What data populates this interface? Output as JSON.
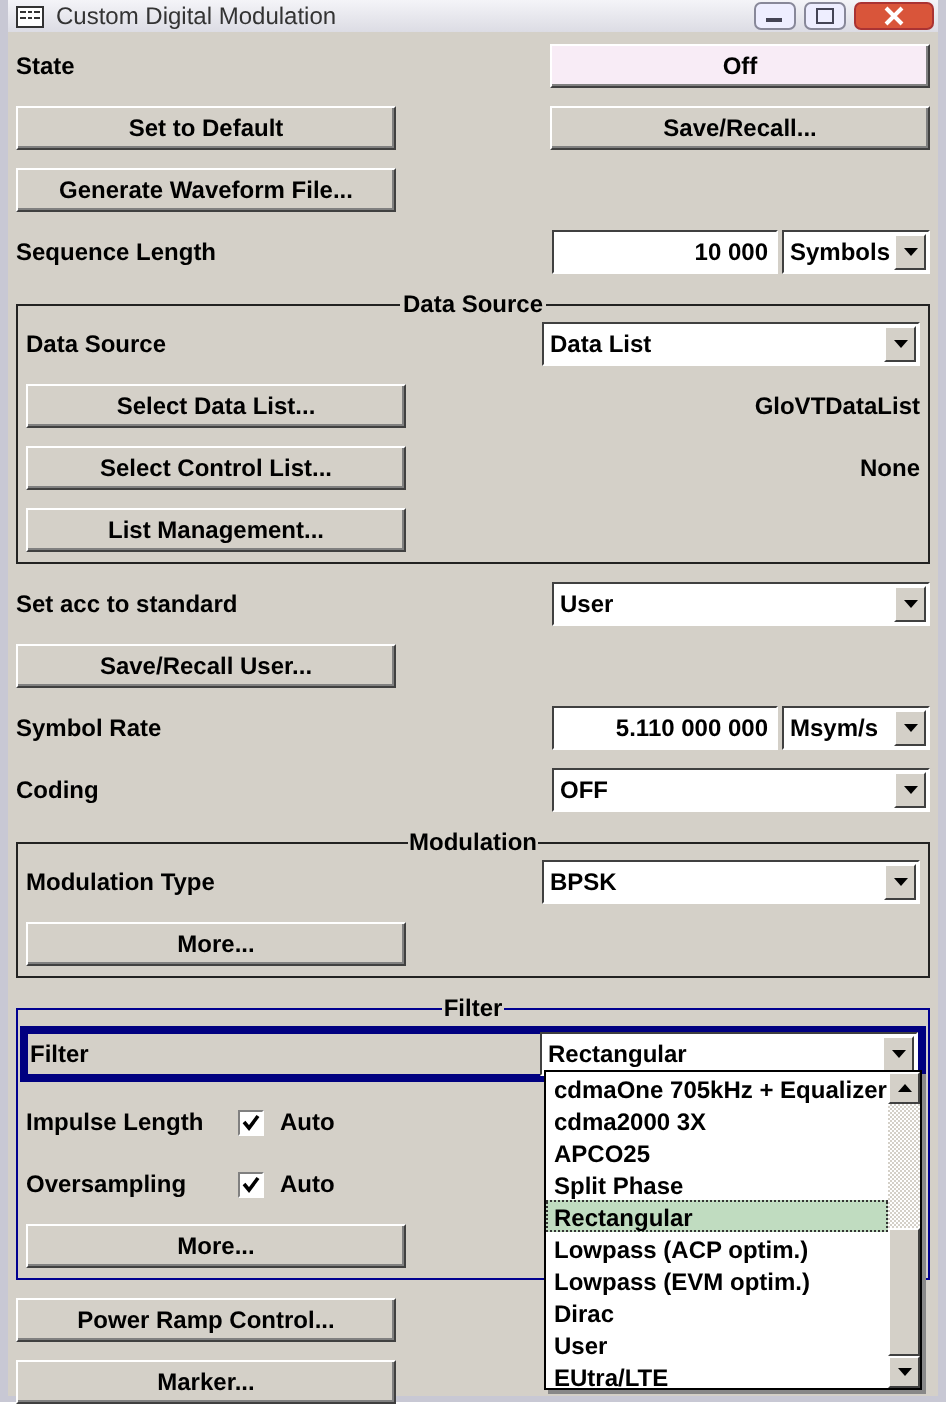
{
  "window": {
    "title": "Custom Digital Modulation"
  },
  "items": [
    {
      "kind": "toggle",
      "label": "State",
      "value": "Off"
    },
    {
      "kind": "buttons",
      "buttons": [
        "Set to Default",
        "Save/Recall..."
      ]
    },
    {
      "kind": "button",
      "label": "Generate Waveform File..."
    },
    {
      "kind": "number",
      "label": "Sequence Length",
      "value": "10 000",
      "unit": "Symbols"
    },
    {
      "kind": "group",
      "title": "Data Source",
      "focused": false,
      "items": [
        {
          "kind": "select",
          "label": "Data Source",
          "value": "Data List"
        },
        {
          "kind": "button_info",
          "label": "Select Data List...",
          "info": "GloVTDataList"
        },
        {
          "kind": "button_info",
          "label": "Select Control List...",
          "info": "None"
        },
        {
          "kind": "button",
          "label": "List Management..."
        }
      ]
    },
    {
      "kind": "select",
      "label": "Set acc to standard",
      "value": "User"
    },
    {
      "kind": "button",
      "label": "Save/Recall User..."
    },
    {
      "kind": "number",
      "label": "Symbol Rate",
      "value": "5.110 000 000",
      "unit": "Msym/s"
    },
    {
      "kind": "select",
      "label": "Coding",
      "value": "OFF"
    },
    {
      "kind": "group",
      "title": "Modulation",
      "focused": false,
      "items": [
        {
          "kind": "select",
          "label": "Modulation Type",
          "value": "BPSK"
        },
        {
          "kind": "button",
          "label": "More..."
        }
      ]
    },
    {
      "kind": "group",
      "title": "Filter",
      "focused": true,
      "items": [
        {
          "kind": "select",
          "label": "Filter",
          "value": "Rectangular",
          "focused": true,
          "expanded": true,
          "options": [
            {
              "label": "cdmaOne 705kHz + Equalizer",
              "selected": false
            },
            {
              "label": "cdma2000 3X",
              "selected": false
            },
            {
              "label": "APCO25",
              "selected": false
            },
            {
              "label": "Split Phase",
              "selected": false
            },
            {
              "label": "Rectangular",
              "selected": true
            },
            {
              "label": "Lowpass (ACP optim.)",
              "selected": false
            },
            {
              "label": "Lowpass (EVM optim.)",
              "selected": false
            },
            {
              "label": "Dirac",
              "selected": false
            },
            {
              "label": "User",
              "selected": false
            },
            {
              "label": "EUtra/LTE",
              "selected": false
            }
          ]
        },
        {
          "kind": "checkbox",
          "label": "Impulse Length",
          "checked": true,
          "text": "Auto"
        },
        {
          "kind": "checkbox",
          "label": "Oversampling",
          "checked": true,
          "text": "Auto"
        },
        {
          "kind": "button",
          "label": "More..."
        }
      ]
    },
    {
      "kind": "button",
      "label": "Power Ramp Control..."
    },
    {
      "kind": "button",
      "label": "Marker..."
    }
  ]
}
